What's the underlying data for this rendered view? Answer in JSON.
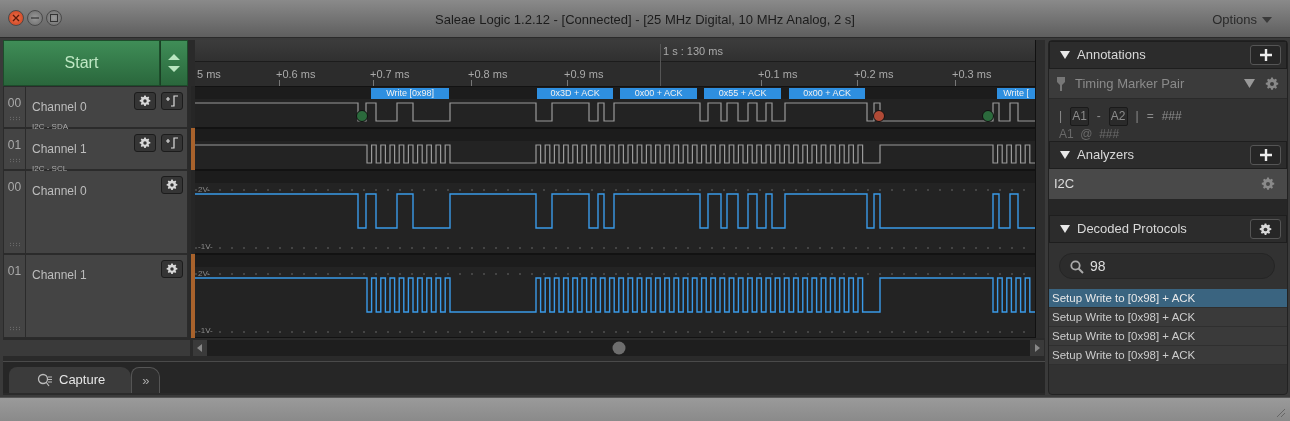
{
  "window": {
    "title": "Saleae Logic 1.2.12 - [Connected] - [25 MHz Digital, 10 MHz Analog, 2 s]",
    "menu": "Options"
  },
  "capture": {
    "start_label": "Start"
  },
  "timeline": {
    "center_time": "1 s : 130 ms",
    "ticks": [
      "5 ms",
      "+0.6 ms",
      "+0.7 ms",
      "+0.8 ms",
      "+0.9 ms",
      "+0.1 ms",
      "+0.2 ms",
      "+0.3 ms"
    ]
  },
  "channels": [
    {
      "kind": "digital",
      "number": "00",
      "name": "Channel 0",
      "analyzer_label": "I2C - SDA",
      "color": "#262626",
      "annotations": [
        "Write [0x98]",
        "0x3D + ACK",
        "0x00 + ACK",
        "0x55 + ACK",
        "0x00 + ACK",
        "Write ["
      ]
    },
    {
      "kind": "digital",
      "number": "01",
      "name": "Channel 1",
      "analyzer_label": "I2C - SCL",
      "color": "#a8622c"
    },
    {
      "kind": "analog",
      "number": "00",
      "name": "Channel 0",
      "color": "#262626",
      "scale_top": "2V-",
      "scale_bottom": "-1V-"
    },
    {
      "kind": "analog",
      "number": "01",
      "name": "Channel 1",
      "color": "#a8622c",
      "scale_top": "2V-",
      "scale_bottom": "-1V-"
    }
  ],
  "bottom_tabs": [
    {
      "label": "Capture",
      "selected": true
    },
    {
      "label": "»",
      "selected": false
    }
  ],
  "sidebar": {
    "annotations": {
      "title": "Annotations",
      "expanded": true,
      "marker_pair": "Timing Marker Pair",
      "formula": [
        {
          "kind": "text",
          "text": "|"
        },
        {
          "kind": "box",
          "text": "A1"
        },
        {
          "kind": "text",
          "text": "-"
        },
        {
          "kind": "box",
          "text": "A2"
        },
        {
          "kind": "text",
          "text": "|"
        },
        {
          "kind": "text",
          "text": "="
        },
        {
          "kind": "text",
          "text": "###"
        }
      ],
      "second_line": "A1  @  ###"
    },
    "analyzers": {
      "title": "Analyzers",
      "expanded": true,
      "items": [
        "I2C"
      ]
    },
    "decoded": {
      "title": "Decoded Protocols",
      "expanded": true,
      "search": "98",
      "results": [
        {
          "text": "Setup Write to [0x98] + ACK",
          "selected": true
        },
        {
          "text": "Setup Write to [0x98] + ACK",
          "selected": false
        },
        {
          "text": "Setup Write to [0x98] + ACK",
          "selected": false
        },
        {
          "text": "Setup Write to [0x98] + ACK",
          "selected": false
        }
      ]
    }
  }
}
